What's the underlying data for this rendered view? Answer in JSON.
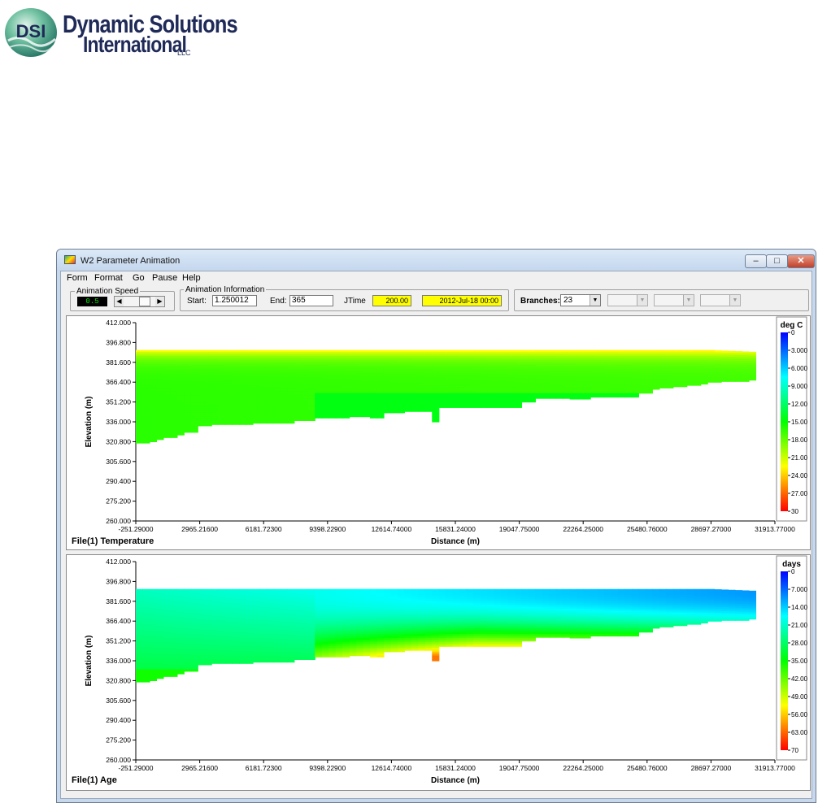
{
  "logo": {
    "mark": "DSI",
    "line1": "Dynamic Solutions",
    "line2": "International",
    "suffix": "LLC"
  },
  "window": {
    "title": "W2 Parameter Animation",
    "minimize_glyph": "‒",
    "maximize_glyph": "□",
    "close_glyph": "✕"
  },
  "menu": [
    "Form",
    "Format",
    "Go",
    "Pause",
    "Help"
  ],
  "toolbar": {
    "speed_group_label": "Animation Speed",
    "speed_value": "0.5",
    "info_group_label": "Animation Information",
    "start_label": "Start:",
    "start_value": "1.250012",
    "end_label": "End:",
    "end_value": "365",
    "jtime_label": "JTime",
    "jtime_value": "200.00",
    "date_value": "2012-Jul-18 00:00",
    "branches_label": "Branches:",
    "branches_value": "23",
    "colors": {
      "highlight": "#ffff00",
      "lcd_text": "#00e000"
    }
  },
  "chart_data": [
    {
      "type": "heatmap",
      "title": "File(1) Temperature",
      "xlabel": "Distance (m)",
      "ylabel": "Elevation (m)",
      "xlim": [
        -251.29,
        31913.77
      ],
      "ylim": [
        260.0,
        412.0
      ],
      "x_ticks": [
        "-251.29000",
        "2965.21600",
        "6181.72300",
        "9398.22900",
        "12614.74000",
        "15831.24000",
        "19047.75000",
        "22264.25000",
        "25480.76000",
        "28697.27000",
        "31913.77000"
      ],
      "y_ticks": [
        "412.000",
        "396.800",
        "381.600",
        "366.400",
        "351.200",
        "336.000",
        "320.800",
        "305.600",
        "290.400",
        "275.200",
        "260.000"
      ],
      "colorbar": {
        "title": "deg C",
        "ticks": [
          "0",
          "3.000",
          "6.000",
          "9.000",
          "12.00",
          "15.00",
          "18.00",
          "21.00",
          "24.00",
          "27.00",
          "30"
        ],
        "range": [
          0,
          30
        ],
        "colors": [
          "#0000ff",
          "#00ffff",
          "#00ff00",
          "#ffff00",
          "#ff0000"
        ]
      },
      "water_surface_elevation": 391.0,
      "surface_value": 22.5,
      "deep_value": 16.5
    },
    {
      "type": "heatmap",
      "title": "File(1) Age",
      "xlabel": "Distance (m)",
      "ylabel": "Elevation (m)",
      "xlim": [
        -251.29,
        31913.77
      ],
      "ylim": [
        260.0,
        412.0
      ],
      "x_ticks": [
        "-251.29000",
        "2965.21600",
        "6181.72300",
        "9398.22900",
        "12614.74000",
        "15831.24000",
        "19047.75000",
        "22264.25000",
        "25480.76000",
        "28697.27000",
        "31913.77000"
      ],
      "y_ticks": [
        "412.000",
        "396.800",
        "381.600",
        "366.400",
        "351.200",
        "336.000",
        "320.800",
        "305.600",
        "290.400",
        "275.200",
        "260.000"
      ],
      "colorbar": {
        "title": "days",
        "ticks": [
          "0",
          "7.000",
          "14.00",
          "21.00",
          "28.00",
          "35.00",
          "42.00",
          "49.00",
          "56.00",
          "63.00",
          "70"
        ],
        "range": [
          0,
          70
        ],
        "colors": [
          "#0000ff",
          "#00ffff",
          "#00ff00",
          "#ffff00",
          "#ff0000"
        ]
      },
      "water_surface_elevation": 391.0,
      "surface_value_upstream": 22,
      "surface_value_downstream": 10,
      "bottom_value_upstream": 36,
      "bottom_value_downstream": 68
    }
  ],
  "bathymetry": {
    "unit_note": "bottom elevation (m) at distance (m)",
    "x": [
      -251.29,
      270,
      760,
      1240,
      1740,
      2220,
      2720,
      3520,
      5470,
      7580,
      8610,
      8760,
      10350,
      11600,
      12270,
      13310,
      14730,
      15130,
      19000,
      19960,
      21480,
      22780,
      25000,
      25720,
      26220,
      26860,
      27450,
      28130,
      28590,
      29180,
      30450,
      31913.77
    ],
    "bottom": [
      319.8,
      320.8,
      322.5,
      324.0,
      326.0,
      328.0,
      333.0,
      334.0,
      335.0,
      337.0,
      350.0,
      339.0,
      340.0,
      339.0,
      343.0,
      344.0,
      336.0,
      347.0,
      351.2,
      354.0,
      353.5,
      355.0,
      358.0,
      361.0,
      362.0,
      363.0,
      364.0,
      365.0,
      366.4,
      367.0,
      368.0,
      368.0
    ]
  }
}
